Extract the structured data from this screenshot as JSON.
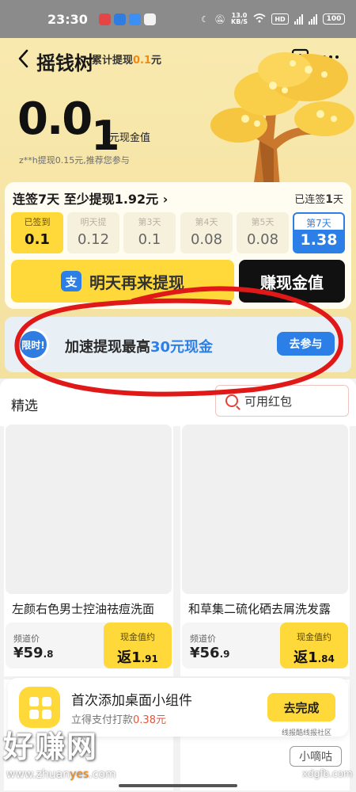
{
  "status_bar": {
    "time": "23:30",
    "net_speed_top": "13.0",
    "net_speed_unit": "KB/S",
    "hd": "HD",
    "signal": "5G",
    "battery": "100"
  },
  "header": {
    "title": "摇钱树",
    "total_label": "累计提现",
    "total_amount": "0.1",
    "total_unit": "元"
  },
  "balance": {
    "int_part": "0.0",
    "last_digit": "1",
    "unit": "元现金值",
    "recent": "z**h提现0.15元,推荐您参与"
  },
  "checkin": {
    "title": "连签7天 至少提现1.92元",
    "status_prefix": "已连签",
    "status_days": "1",
    "status_suffix": "天",
    "days": [
      {
        "label": "已签到",
        "value": "0.1"
      },
      {
        "label": "明天提",
        "value": "0.12"
      },
      {
        "label": "第3天",
        "value": "0.1"
      },
      {
        "label": "第4天",
        "value": "0.08"
      },
      {
        "label": "第5天",
        "value": "0.08"
      },
      {
        "label": "第7天",
        "value": "1.38"
      }
    ],
    "tomorrow_button": "明天再来提现",
    "earn_button": "赚现金值"
  },
  "promo": {
    "badge": "限时!",
    "text_before": "加速提现最高",
    "text_highlight": "30元现金",
    "button": "去参与"
  },
  "feed": {
    "title": "精选",
    "red_packet": "可用红包",
    "products": [
      {
        "name": "左颜右色男士控油祛痘洗面",
        "price_label": "频道价",
        "price_main": "¥59",
        "price_dec": ".8",
        "rebate_label": "现金值约",
        "rebate_main": "返1",
        "rebate_dec": ".91"
      },
      {
        "name": "和草集二硫化硒去屑洗发露",
        "price_label": "频道价",
        "price_main": "¥56",
        "price_dec": ".9",
        "rebate_label": "现金值约",
        "rebate_main": "返1",
        "rebate_dec": ".84"
      }
    ]
  },
  "widget": {
    "title": "首次添加桌面小组件",
    "sub_before": "立得支付打款",
    "sub_amount": "0.38元",
    "button": "去完成"
  },
  "watermarks": {
    "main": "好赚网",
    "url_before": "www.zhuan",
    "url_orange": "yes",
    "url_after": ".com",
    "small": "xdgfb.com",
    "brand": "小嘀咕",
    "brand_caption": "线报酷线报社区"
  },
  "colors": {
    "accent_yellow": "#ffd93a",
    "accent_blue": "#2d7fe8",
    "amount_orange": "#f08a12",
    "annotation_red": "#e01818"
  }
}
